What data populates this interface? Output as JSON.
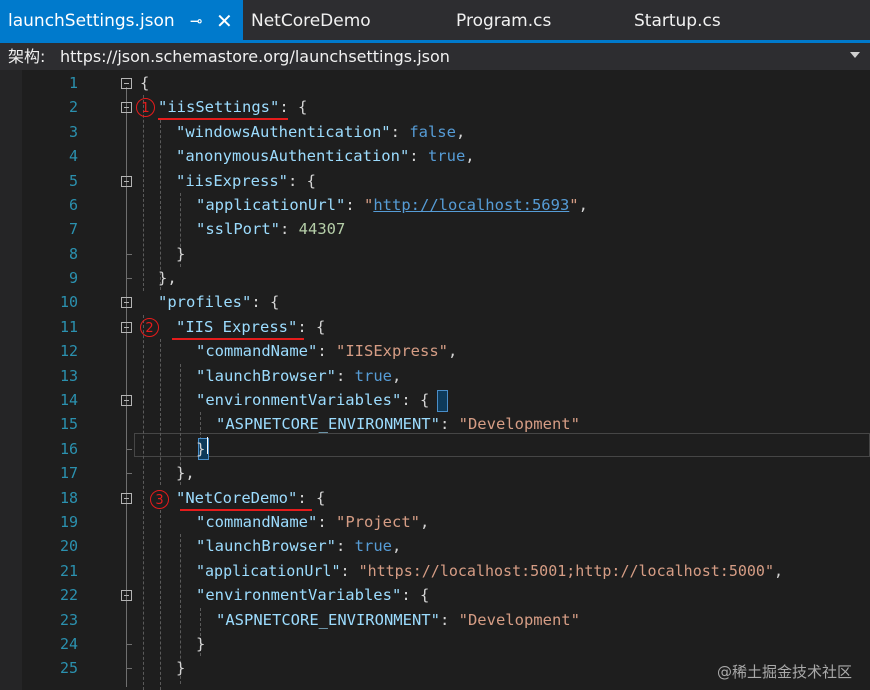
{
  "tabs": [
    {
      "label": "launchSettings.json",
      "active": true,
      "pin_icon": "pin-icon",
      "close_icon": "close-icon"
    },
    {
      "label": "NetCoreDemo",
      "active": false
    },
    {
      "label": "Program.cs",
      "active": false
    },
    {
      "label": "Startup.cs",
      "active": false
    }
  ],
  "schema": {
    "label": "架构:",
    "url": "https://json.schemastore.org/launchsettings.json"
  },
  "lines": [
    {
      "n": "1"
    },
    {
      "n": "2"
    },
    {
      "n": "3"
    },
    {
      "n": "4"
    },
    {
      "n": "5"
    },
    {
      "n": "6"
    },
    {
      "n": "7"
    },
    {
      "n": "8"
    },
    {
      "n": "9"
    },
    {
      "n": "10"
    },
    {
      "n": "11"
    },
    {
      "n": "12"
    },
    {
      "n": "13"
    },
    {
      "n": "14"
    },
    {
      "n": "15"
    },
    {
      "n": "16"
    },
    {
      "n": "17"
    },
    {
      "n": "18"
    },
    {
      "n": "19"
    },
    {
      "n": "20"
    },
    {
      "n": "21"
    },
    {
      "n": "22"
    },
    {
      "n": "23"
    },
    {
      "n": "24"
    },
    {
      "n": "25"
    }
  ],
  "code": {
    "l1_brace": "{",
    "l2_key": "\"iisSettings\"",
    "l2_rest": ": {",
    "l3_key": "\"windowsAuthentication\"",
    "l3_colon": ": ",
    "l3_val": "false",
    "l3_comma": ",",
    "l4_key": "\"anonymousAuthentication\"",
    "l4_colon": ": ",
    "l4_val": "true",
    "l4_comma": ",",
    "l5_key": "\"iisExpress\"",
    "l5_rest": ": {",
    "l6_key": "\"applicationUrl\"",
    "l6_colon": ": ",
    "l6_q1": "\"",
    "l6_url": "http://localhost:5693",
    "l6_q2": "\"",
    "l6_comma": ",",
    "l7_key": "\"sslPort\"",
    "l7_colon": ": ",
    "l7_val": "44307",
    "l8_text": "}",
    "l9_text": "},",
    "l10_key": "\"profiles\"",
    "l10_rest": ": {",
    "l11_key": "\"IIS Express\"",
    "l11_rest": ": {",
    "l12_key": "\"commandName\"",
    "l12_colon": ": ",
    "l12_val": "\"IISExpress\"",
    "l12_comma": ",",
    "l13_key": "\"launchBrowser\"",
    "l13_colon": ": ",
    "l13_val": "true",
    "l13_comma": ",",
    "l14_key": "\"environmentVariables\"",
    "l14_colon": ": ",
    "l14_brace": "{",
    "l15_key": "\"ASPNETCORE_ENVIRONMENT\"",
    "l15_colon": ": ",
    "l15_val": "\"Development\"",
    "l16_text": "}",
    "l17_text": "},",
    "l18_key": "\"NetCoreDemo\"",
    "l18_rest": ": {",
    "l19_key": "\"commandName\"",
    "l19_colon": ": ",
    "l19_val": "\"Project\"",
    "l19_comma": ",",
    "l20_key": "\"launchBrowser\"",
    "l20_colon": ": ",
    "l20_val": "true",
    "l20_comma": ",",
    "l21_key": "\"applicationUrl\"",
    "l21_colon": ": ",
    "l21_val": "\"https://localhost:5001;http://localhost:5000\"",
    "l21_comma": ",",
    "l22_key": "\"environmentVariables\"",
    "l22_rest": ": {",
    "l23_key": "\"ASPNETCORE_ENVIRONMENT\"",
    "l23_colon": ": ",
    "l23_val": "\"Development\"",
    "l24_text": "}",
    "l25_text": "}"
  },
  "annotations": {
    "m1": "1",
    "m2": "2",
    "m3": "3"
  },
  "watermark": "@稀土掘金技术社区",
  "colors": {
    "accent": "#007acc",
    "annotation": "#e51c1c",
    "line_number": "#2b91af"
  }
}
